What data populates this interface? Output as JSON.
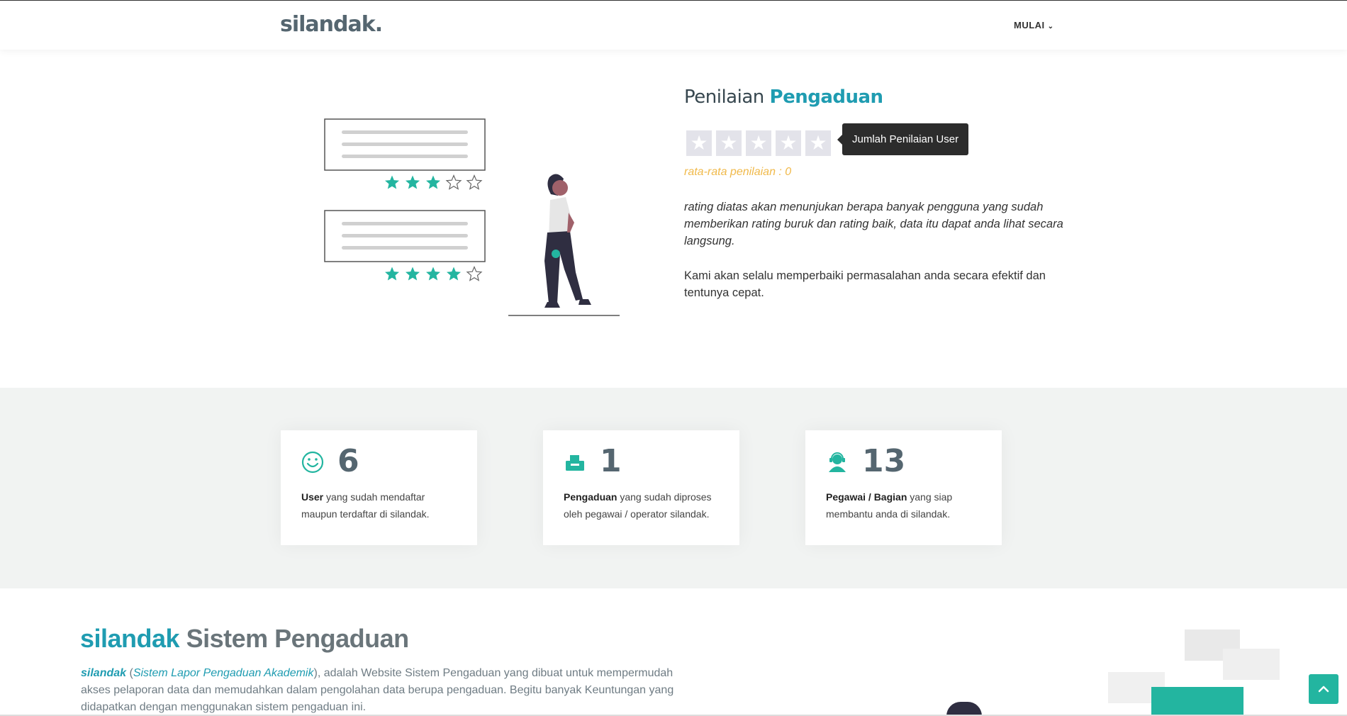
{
  "navbar": {
    "brand": "silandak.",
    "menu_label": "MULAI"
  },
  "rating": {
    "title_plain": "Penilaian ",
    "title_accent": "Pengaduan",
    "stars": [
      "★",
      "★",
      "★",
      "★",
      "★"
    ],
    "tooltip": "Jumlah Penilaian User",
    "average_text": "rata-rata penilaian : 0",
    "description": "rating diatas akan menunjukan berapa banyak pengguna yang sudah memberikan rating buruk dan rating baik, data itu dapat anda lihat secara langsung.",
    "description2": "Kami akan selalu memperbaiki permasalahan anda secara efektif dan tentunya cepat.",
    "illustration_ratings": [
      3,
      4
    ]
  },
  "stats": [
    {
      "icon": "smile-icon",
      "number": "6",
      "bold": "User",
      "text": " yang sudah mendaftar maupun terdaftar di silandak."
    },
    {
      "icon": "inbox-tray-icon",
      "number": "1",
      "bold": "Pengaduan",
      "text": " yang sudah diproses oleh pegawai / operator silandak."
    },
    {
      "icon": "support-agent-icon",
      "number": "13",
      "bold": "Pegawai / Bagian",
      "text": " yang siap membantu anda di silandak."
    }
  ],
  "about": {
    "title_accent": "silandak",
    "title_plain": " Sistem Pengaduan",
    "brand": "silandak",
    "open_paren": " (",
    "expansion": "Sistem Lapor Pengaduan Akademik",
    "rest": "), adalah Website Sistem Pengaduan yang dibuat untuk mempermudah akses pelaporan data dan memudahkan dalam pengolahan data berupa pengaduan. Begitu banyak Keuntungan yang didapatkan dengan menggunakan sistem pengaduan ini."
  },
  "colors": {
    "accent": "#1f9cb1",
    "teal": "#23b5a0",
    "star_gold": "#f0b94a",
    "stats_bg": "#f1f3f2"
  },
  "back_to_top_icon": "chevron-up-icon"
}
